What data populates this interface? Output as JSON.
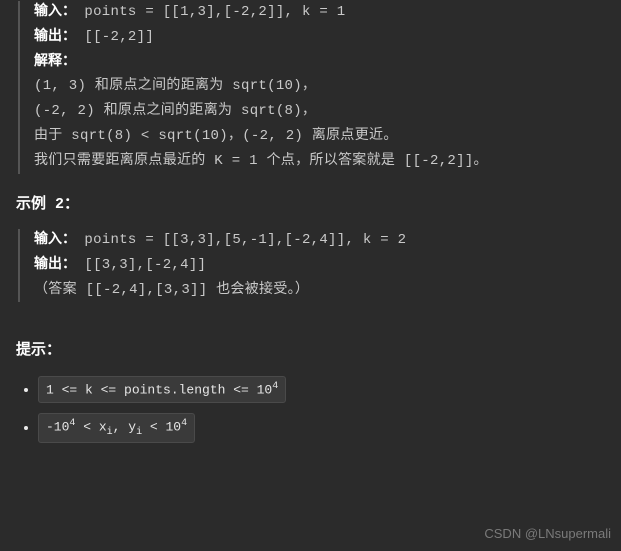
{
  "example1": {
    "input_label": "输入：",
    "input_value": "points = [[1,3],[-2,2]], k = 1",
    "output_label": "输出：",
    "output_value": "[[-2,2]]",
    "explain_label": "解释：",
    "lines": [
      "(1, 3) 和原点之间的距离为 sqrt(10)，",
      "(-2, 2) 和原点之间的距离为 sqrt(8)，",
      "由于 sqrt(8) < sqrt(10)，(-2, 2) 离原点更近。",
      "我们只需要距离原点最近的 K = 1 个点，所以答案就是 [[-2,2]]。"
    ]
  },
  "example2_heading": "示例 2：",
  "example2": {
    "input_label": "输入：",
    "input_value": "points = [[3,3],[5,-1],[-2,4]], k = 2",
    "output_label": "输出：",
    "output_value": "[[3,3],[-2,4]]",
    "note": "（答案 [[-2,4],[3,3]] 也会被接受。）"
  },
  "hints_heading": "提示：",
  "hints": {
    "h1_a": "1 <= k <= points.length <= 10",
    "h1_sup": "4",
    "h2_a": "-10",
    "h2_b": " < x",
    "h2_c": ", y",
    "h2_d": " < 10",
    "h2_sup": "4",
    "h2_sub": "i"
  },
  "watermark": "CSDN @LNsupermali"
}
